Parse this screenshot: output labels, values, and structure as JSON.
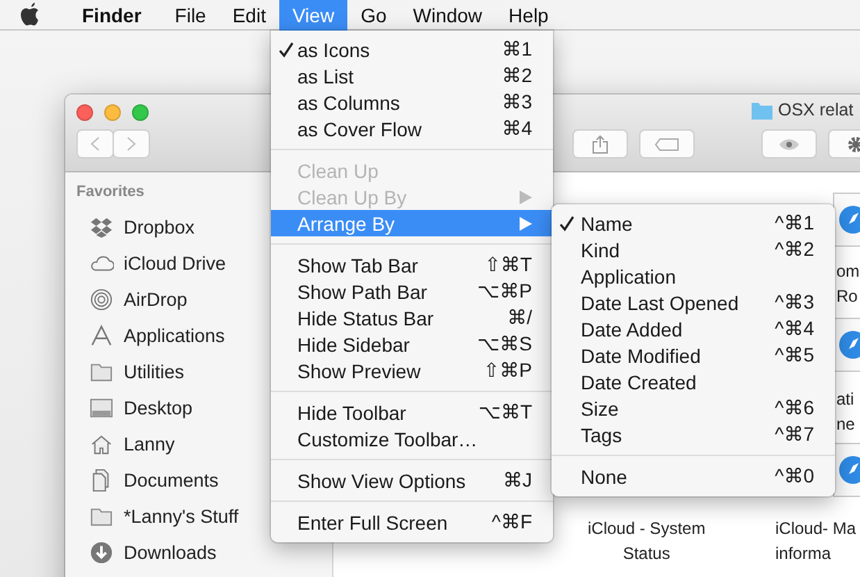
{
  "menu_bar": {
    "items": [
      {
        "label": "Finder",
        "kind": "app",
        "selected": false
      },
      {
        "label": "File",
        "kind": "menu",
        "selected": false
      },
      {
        "label": "Edit",
        "kind": "menu",
        "selected": false
      },
      {
        "label": "View",
        "kind": "menu",
        "selected": true
      },
      {
        "label": "Go",
        "kind": "menu",
        "selected": false
      },
      {
        "label": "Window",
        "kind": "menu",
        "selected": false
      },
      {
        "label": "Help",
        "kind": "menu",
        "selected": false
      }
    ]
  },
  "finder_window": {
    "title": "OSX relat",
    "sidebar": {
      "heading": "Favorites",
      "items": [
        {
          "label": "Dropbox"
        },
        {
          "label": "iCloud Drive"
        },
        {
          "label": "AirDrop"
        },
        {
          "label": "Applications"
        },
        {
          "label": "Utilities"
        },
        {
          "label": "Desktop"
        },
        {
          "label": "Lanny"
        },
        {
          "label": "Documents"
        },
        {
          "label": "*Lanny's Stuff"
        },
        {
          "label": "Downloads"
        }
      ]
    },
    "files": [
      {
        "lines": [
          "om",
          "Ro"
        ]
      },
      {
        "lines": [
          "ati",
          "ne"
        ]
      },
      {
        "lines": [
          "iCloud - System",
          "Status"
        ]
      },
      {
        "lines": [
          "iCloud- Ma",
          "informa"
        ]
      }
    ]
  },
  "view_menu": {
    "groups": [
      [
        {
          "label": "as Icons",
          "shortcut": "⌘1",
          "checked": true,
          "disabled": false,
          "highlighted": false,
          "submenu": false
        },
        {
          "label": "as List",
          "shortcut": "⌘2",
          "checked": false,
          "disabled": false,
          "highlighted": false,
          "submenu": false
        },
        {
          "label": "as Columns",
          "shortcut": "⌘3",
          "checked": false,
          "disabled": false,
          "highlighted": false,
          "submenu": false
        },
        {
          "label": "as Cover Flow",
          "shortcut": "⌘4",
          "checked": false,
          "disabled": false,
          "highlighted": false,
          "submenu": false
        }
      ],
      [
        {
          "label": "Clean Up",
          "checked": false,
          "disabled": true,
          "highlighted": false,
          "submenu": false
        },
        {
          "label": "Clean Up By",
          "checked": false,
          "disabled": true,
          "highlighted": false,
          "submenu": true
        },
        {
          "label": "Arrange By",
          "checked": false,
          "disabled": false,
          "highlighted": true,
          "submenu": true
        }
      ],
      [
        {
          "label": "Show Tab Bar",
          "shortcut": "⇧⌘T",
          "checked": false,
          "disabled": false,
          "highlighted": false,
          "submenu": false
        },
        {
          "label": "Show Path Bar",
          "shortcut": "⌥⌘P",
          "checked": false,
          "disabled": false,
          "highlighted": false,
          "submenu": false
        },
        {
          "label": "Hide Status Bar",
          "shortcut": "⌘/",
          "checked": false,
          "disabled": false,
          "highlighted": false,
          "submenu": false
        },
        {
          "label": "Hide Sidebar",
          "shortcut": "⌥⌘S",
          "checked": false,
          "disabled": false,
          "highlighted": false,
          "submenu": false
        },
        {
          "label": "Show Preview",
          "shortcut": "⇧⌘P",
          "checked": false,
          "disabled": false,
          "highlighted": false,
          "submenu": false
        }
      ],
      [
        {
          "label": "Hide Toolbar",
          "shortcut": "⌥⌘T",
          "checked": false,
          "disabled": false,
          "highlighted": false,
          "submenu": false
        },
        {
          "label": "Customize Toolbar…",
          "checked": false,
          "disabled": false,
          "highlighted": false,
          "submenu": false
        }
      ],
      [
        {
          "label": "Show View Options",
          "shortcut": "⌘J",
          "checked": false,
          "disabled": false,
          "highlighted": false,
          "submenu": false
        }
      ],
      [
        {
          "label": "Enter Full Screen",
          "shortcut": "^⌘F",
          "checked": false,
          "disabled": false,
          "highlighted": false,
          "submenu": false
        }
      ]
    ]
  },
  "arrange_submenu": {
    "groups": [
      [
        {
          "label": "Name",
          "shortcut": "^⌘1",
          "checked": true
        },
        {
          "label": "Kind",
          "shortcut": "^⌘2",
          "checked": false
        },
        {
          "label": "Application",
          "checked": false
        },
        {
          "label": "Date Last Opened",
          "shortcut": "^⌘3",
          "checked": false
        },
        {
          "label": "Date Added",
          "shortcut": "^⌘4",
          "checked": false
        },
        {
          "label": "Date Modified",
          "shortcut": "^⌘5",
          "checked": false
        },
        {
          "label": "Date Created",
          "checked": false
        },
        {
          "label": "Size",
          "shortcut": "^⌘6",
          "checked": false
        },
        {
          "label": "Tags",
          "shortcut": "^⌘7",
          "checked": false
        }
      ],
      [
        {
          "label": "None",
          "shortcut": "^⌘0",
          "checked": false
        }
      ]
    ]
  }
}
